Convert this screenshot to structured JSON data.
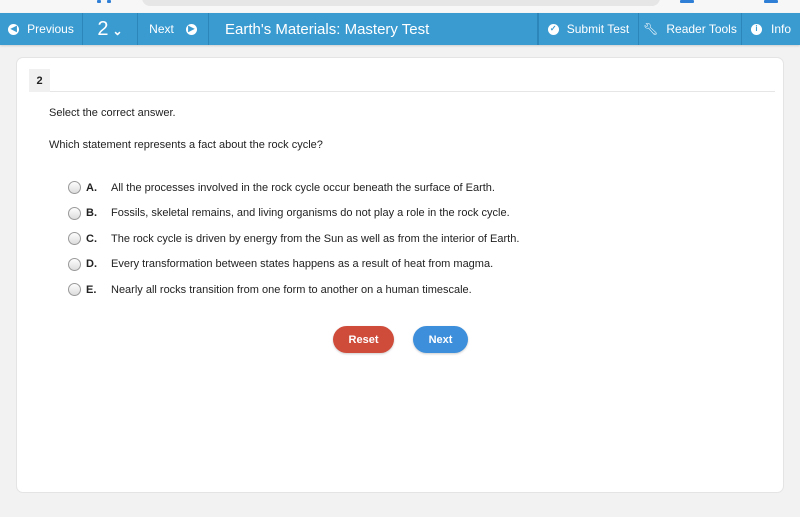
{
  "navbar": {
    "previous_label": "Previous",
    "question_number": "2",
    "next_label": "Next",
    "title": "Earth's Materials: Mastery Test",
    "submit_label": "Submit Test",
    "reader_tools_label": "Reader Tools",
    "info_label": "Info",
    "accent_color": "#3a9bd1"
  },
  "question": {
    "number": "2",
    "instruction": "Select the correct answer.",
    "prompt": "Which statement represents a fact about the rock cycle?",
    "options": [
      {
        "letter": "A.",
        "text": "All the processes involved in the rock cycle occur beneath the surface of Earth."
      },
      {
        "letter": "B.",
        "text": "Fossils, skeletal remains, and living organisms do not play a role in the rock cycle."
      },
      {
        "letter": "C.",
        "text": "The rock cycle is driven by energy from the Sun as well as from the interior of Earth."
      },
      {
        "letter": "D.",
        "text": "Every transformation between states happens as a result of heat from magma."
      },
      {
        "letter": "E.",
        "text": "Nearly all rocks transition from one form to another on a human timescale."
      }
    ]
  },
  "actions": {
    "reset_label": "Reset",
    "next_label": "Next",
    "reset_color": "#cf4c3b",
    "next_color": "#3d8fdb"
  }
}
